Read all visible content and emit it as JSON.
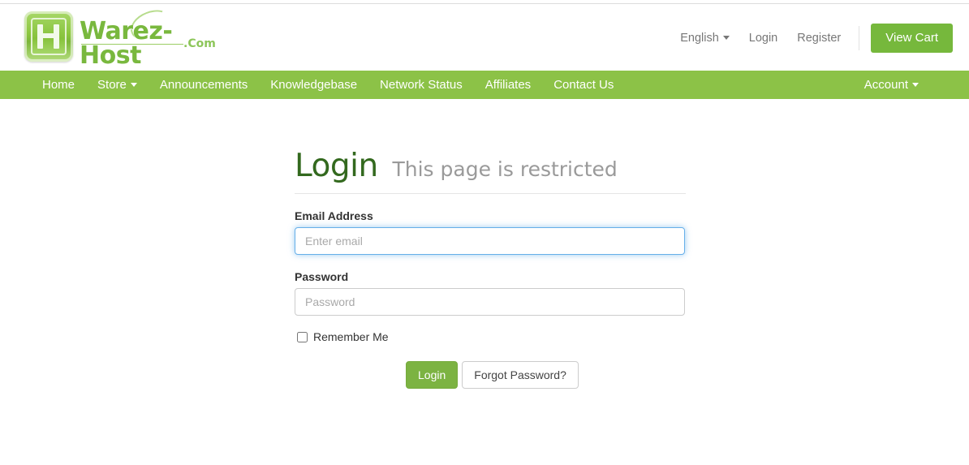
{
  "brand": {
    "name": "Warez-Host",
    "tld": ".Com",
    "mark_icon": "lh-monogram-icon",
    "brand_green": "#79b83e"
  },
  "top_nav": {
    "language": {
      "label": "English",
      "caret_icon": "caret-down-icon"
    },
    "login_label": "Login",
    "register_label": "Register",
    "cart_button_label": "View Cart",
    "cart_button_color": "#76b83c"
  },
  "navbar": {
    "background_color": "#8cc247",
    "left_items": [
      {
        "label": "Home",
        "has_caret": false
      },
      {
        "label": "Store",
        "has_caret": true
      },
      {
        "label": "Announcements",
        "has_caret": false
      },
      {
        "label": "Knowledgebase",
        "has_caret": false
      },
      {
        "label": "Network Status",
        "has_caret": false
      },
      {
        "label": "Affiliates",
        "has_caret": false
      },
      {
        "label": "Contact Us",
        "has_caret": false
      }
    ],
    "right_items": [
      {
        "label": "Account",
        "has_caret": true
      }
    ]
  },
  "login_page": {
    "heading": "Login",
    "subheading": "This page is restricted",
    "heading_color": "#33691e",
    "email": {
      "label": "Email Address",
      "placeholder": "Enter email",
      "value": "",
      "focused": true
    },
    "password": {
      "label": "Password",
      "placeholder": "Password",
      "value": "",
      "focused": false
    },
    "remember": {
      "label": "Remember Me",
      "checked": false
    },
    "submit_label": "Login",
    "forgot_label": "Forgot Password?"
  }
}
